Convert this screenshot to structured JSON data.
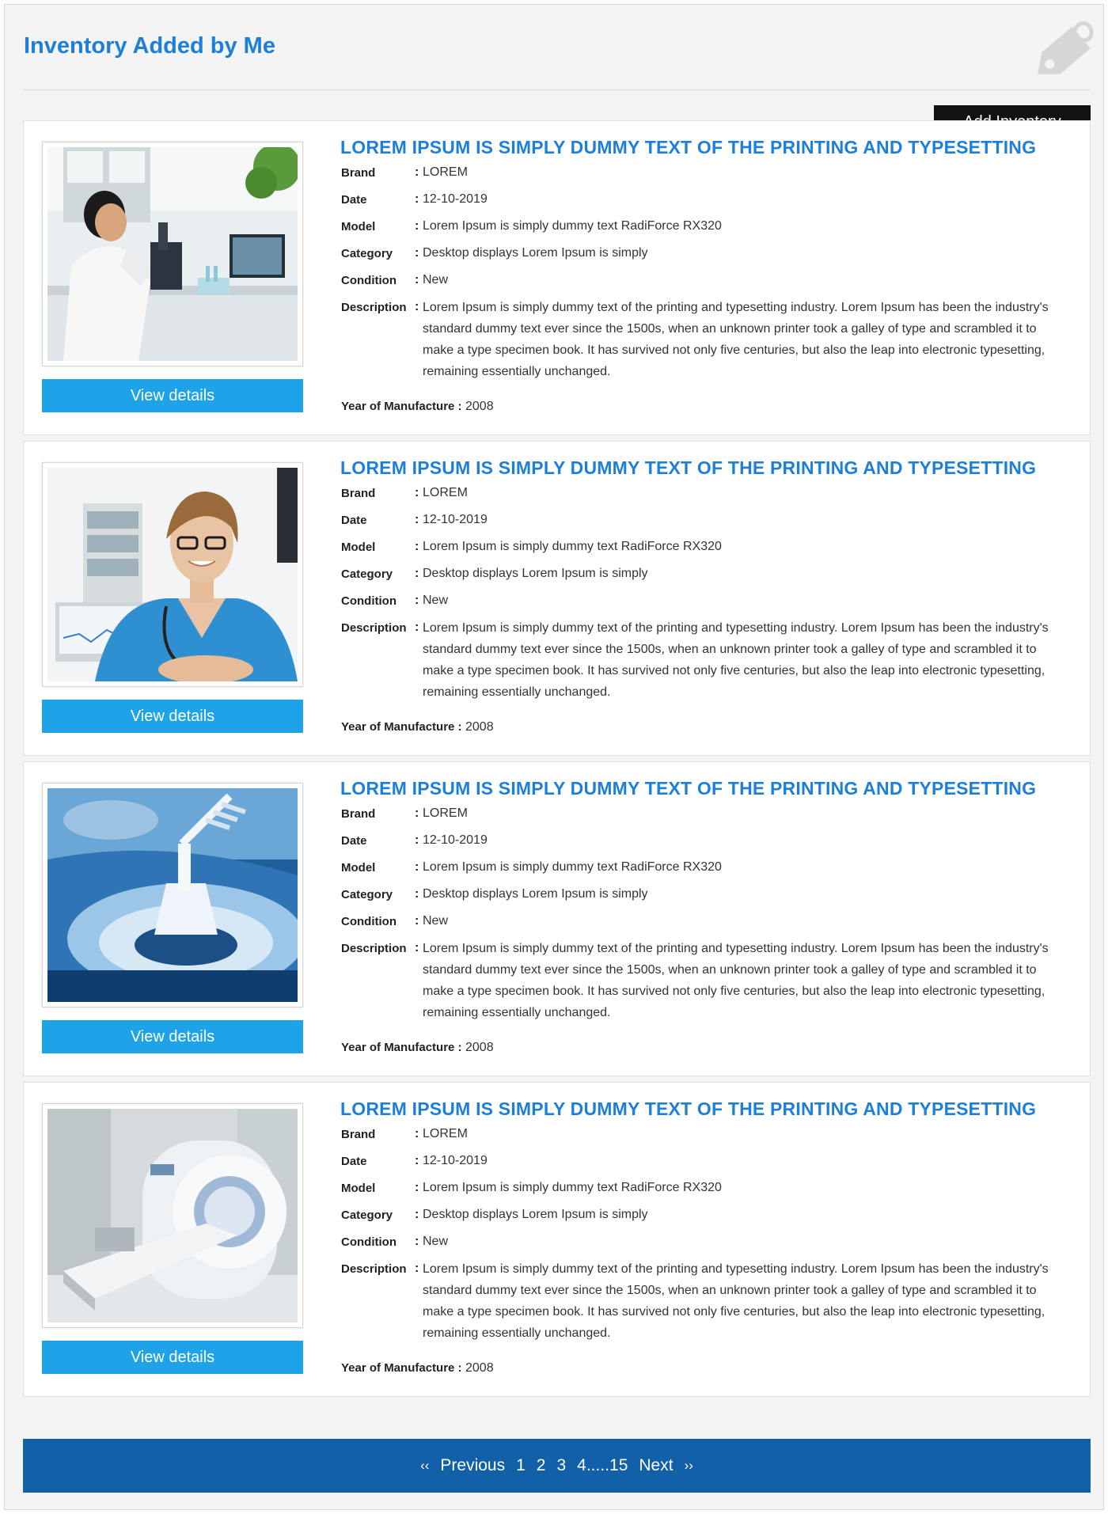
{
  "header": {
    "title": "Inventory Added by Me",
    "add_button": "Add Inventory"
  },
  "items": [
    {
      "title": "LOREM IPSUM IS SIMPLY DUMMY TEXT OF THE PRINTING AND TYPESETTING",
      "image": "lab-scientist-microscope",
      "brand_label": "Brand",
      "brand": "LOREM",
      "date_label": "Date",
      "date": "12-10-2019",
      "model_label": "Model",
      "model": "Lorem Ipsum is simply dummy text RadiForce RX320",
      "category_label": "Category",
      "category": "Desktop displays Lorem Ipsum is simply",
      "condition_label": "Condition",
      "condition": "New",
      "description_label": "Description",
      "description": "Lorem Ipsum is simply dummy text of the printing and typesetting industry. Lorem Ipsum has been the industry's standard dummy text ever since the 1500s, when an unknown printer took a galley of type and scrambled it to make a type specimen book. It has survived not only five centuries, but also the leap into electronic typesetting, remaining essentially unchanged.",
      "year_label": "Year of Manufacture :",
      "year": "2008",
      "view_button": "View details"
    },
    {
      "title": "LOREM IPSUM IS SIMPLY DUMMY TEXT OF THE PRINTING AND TYPESETTING",
      "image": "nurse-with-stethoscope",
      "brand_label": "Brand",
      "brand": "LOREM",
      "date_label": "Date",
      "date": "12-10-2019",
      "model_label": "Model",
      "model": "Lorem Ipsum is simply dummy text RadiForce RX320",
      "category_label": "Category",
      "category": "Desktop displays Lorem Ipsum is simply",
      "condition_label": "Condition",
      "condition": "New",
      "description_label": "Description",
      "description": "Lorem Ipsum is simply dummy text of the printing and typesetting industry. Lorem Ipsum has been the industry's standard dummy text ever since the 1500s, when an unknown printer took a galley of type and scrambled it to make a type specimen book. It has survived not only five centuries, but also the leap into electronic typesetting, remaining essentially unchanged.",
      "year_label": "Year of Manufacture :",
      "year": "2008",
      "view_button": "View details"
    },
    {
      "title": "LOREM IPSUM IS SIMPLY DUMMY TEXT OF THE PRINTING AND TYPESETTING",
      "image": "lab-centrifuge-equipment",
      "brand_label": "Brand",
      "brand": "LOREM",
      "date_label": "Date",
      "date": "12-10-2019",
      "model_label": "Model",
      "model": "Lorem Ipsum is simply dummy text RadiForce RX320",
      "category_label": "Category",
      "category": "Desktop displays Lorem Ipsum is simply",
      "condition_label": "Condition",
      "condition": "New",
      "description_label": "Description",
      "description": "Lorem Ipsum is simply dummy text of the printing and typesetting industry. Lorem Ipsum has been the industry's standard dummy text ever since the 1500s, when an unknown printer took a galley of type and scrambled it to make a type specimen book. It has survived not only five centuries, but also the leap into electronic typesetting, remaining essentially unchanged.",
      "year_label": "Year of Manufacture :",
      "year": "2008",
      "view_button": "View details"
    },
    {
      "title": "LOREM IPSUM IS SIMPLY DUMMY TEXT OF THE PRINTING AND TYPESETTING",
      "image": "mri-scanner",
      "brand_label": "Brand",
      "brand": "LOREM",
      "date_label": "Date",
      "date": "12-10-2019",
      "model_label": "Model",
      "model": "Lorem Ipsum is simply dummy text RadiForce RX320",
      "category_label": "Category",
      "category": "Desktop displays Lorem Ipsum is simply",
      "condition_label": "Condition",
      "condition": "New",
      "description_label": "Description",
      "description": "Lorem Ipsum is simply dummy text of the printing and typesetting industry. Lorem Ipsum has been the industry's standard dummy text ever since the 1500s, when an unknown printer took a galley of type and scrambled it to make a type specimen book. It has survived not only five centuries, but also the leap into electronic typesetting, remaining essentially unchanged.",
      "year_label": "Year of Manufacture :",
      "year": "2008",
      "view_button": "View details"
    }
  ],
  "pagination": {
    "prev_arrow": "‹‹",
    "prev": "Previous",
    "pages": [
      "1",
      "2",
      "3",
      "4.....15"
    ],
    "next": "Next",
    "next_arrow": "››"
  },
  "colors": {
    "accent": "#1e7fd8",
    "button": "#1fa3e8",
    "pager": "#1260a8",
    "dark_button": "#121212"
  },
  "icons": [
    "price-tag-icon"
  ]
}
